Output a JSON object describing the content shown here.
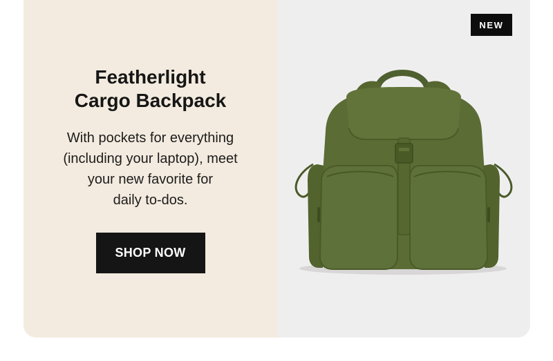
{
  "promo": {
    "title": "Featherlight\nCargo Backpack",
    "description": "With pockets for everything\n(including your laptop), meet\nyour new favorite for\ndaily to-dos.",
    "cta_label": "SHOP NOW",
    "badge": "NEW"
  },
  "colors": {
    "left_panel_bg": "#f3ebdf",
    "right_panel_bg": "#efeeef",
    "button_bg": "#151515",
    "backpack_green": "#5a6b35"
  },
  "product": {
    "icon": "backpack-image"
  }
}
